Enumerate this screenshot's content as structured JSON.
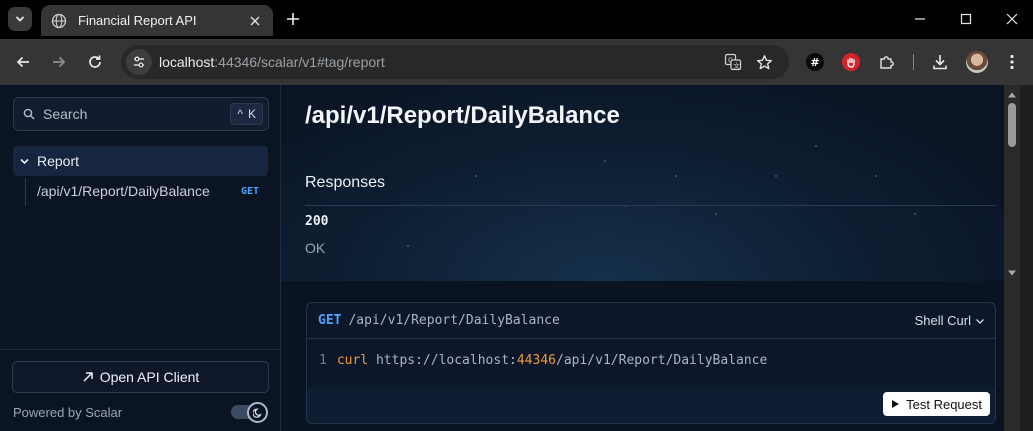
{
  "browser": {
    "tab_title": "Financial Report API",
    "url_host": "localhost",
    "url_rest": ":44346/scalar/v1#tag/report",
    "extensions": [
      {
        "name": "hash-extension",
        "label": "#"
      },
      {
        "name": "hand-extension",
        "label": ""
      }
    ]
  },
  "sidebar": {
    "search_placeholder": "Search",
    "search_shortcut": [
      "^",
      "K"
    ],
    "tag": {
      "label": "Report"
    },
    "operations": [
      {
        "path": "/api/v1/Report/DailyBalance",
        "method": "GET"
      }
    ],
    "open_client_label": "Open API Client",
    "powered_by": "Powered by Scalar"
  },
  "main": {
    "title": "/api/v1/Report/DailyBalance",
    "responses_heading": "Responses",
    "responses": [
      {
        "code": "200",
        "description": "OK"
      }
    ],
    "request": {
      "method": "GET",
      "path": "/api/v1/Report/DailyBalance",
      "language": "Shell Curl",
      "code": {
        "line_number": "1",
        "command": "curl",
        "url_prefix": "https://localhost:",
        "port": "44346",
        "url_suffix": "/api/v1/Report/DailyBalance"
      },
      "test_button": "Test Request"
    }
  },
  "colors": {
    "accent_method": "#4fa3ff",
    "code_keyword": "#f0983e",
    "sidebar_bg": "#0b1423",
    "main_bg": "#0a1322"
  }
}
